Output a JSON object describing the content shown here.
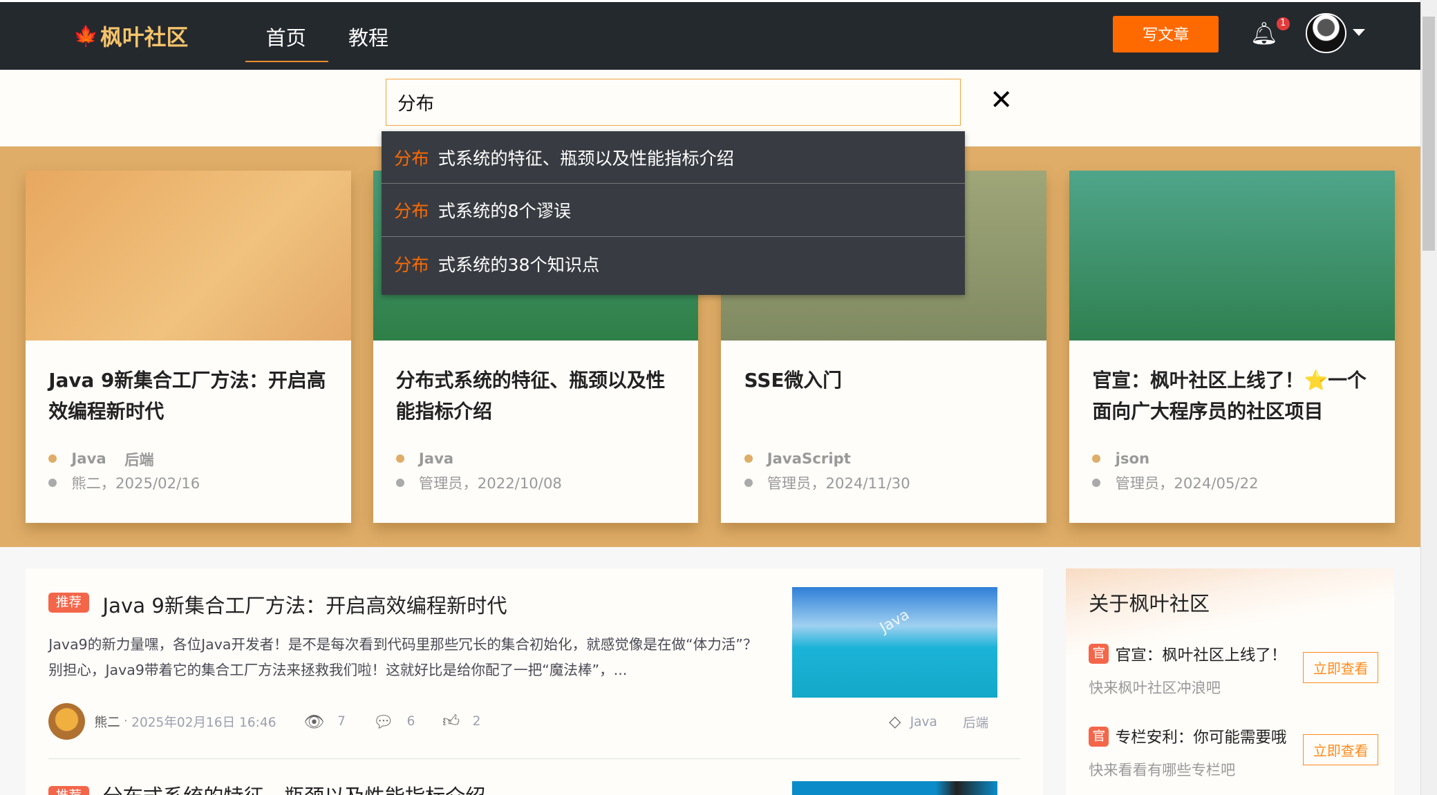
{
  "header": {
    "logo_text": "枫叶社区",
    "nav": [
      {
        "label": "首页",
        "active": true
      },
      {
        "label": "教程",
        "active": false
      }
    ],
    "write_button": "写文章",
    "notification_count": "1",
    "accent_color": "#ff6a00"
  },
  "search": {
    "value": "分布",
    "close_icon": "close-icon",
    "suggestions": [
      {
        "highlight": "分布",
        "rest": "式系统的特征、瓶颈以及性能指标介绍"
      },
      {
        "highlight": "分布",
        "rest": "式系统的8个谬误"
      },
      {
        "highlight": "分布",
        "rest": "式系统的38个知识点"
      }
    ]
  },
  "featured": [
    {
      "title": "Java 9新集合工厂方法：开启高效编程新时代",
      "tags": [
        "Java",
        "后端"
      ],
      "meta": "熊二，2025/02/16"
    },
    {
      "title": "分布式系统的特征、瓶颈以及性能指标介绍",
      "tags": [
        "Java"
      ],
      "meta": "管理员，2022/10/08"
    },
    {
      "title": "SSE微入门",
      "tags": [
        "JavaScript"
      ],
      "meta": "管理员，2024/11/30"
    },
    {
      "title": "官宣：枫叶社区上线了！⭐一个面向广大程序员的社区项目",
      "tags": [
        "json"
      ],
      "meta": "管理员，2024/05/22"
    }
  ],
  "articles": [
    {
      "badge": "推荐",
      "title": "Java 9新集合工厂方法：开启高效编程新时代",
      "summary": "Java9的新力量嘿，各位Java开发者！是不是每次看到代码里那些冗长的集合初始化，就感觉像是在做“体力活”？别担心，Java9带着它的集合工厂方法来拯救我们啦！这就好比是给你配了一把“魔法棒”，...",
      "thumb_text": "Java",
      "author": "熊二",
      "time": "2025年02月16日 16:46",
      "views": "7",
      "comments": "6",
      "likes": "2",
      "tags": [
        "Java",
        "后端"
      ]
    },
    {
      "badge": "推荐",
      "title": "分布式系统的特征、瓶颈以及性能指标介绍"
    }
  ],
  "sidebar": {
    "title": "关于枫叶社区",
    "items": [
      {
        "badge": "官",
        "title": "官宣：枫叶社区上线了！",
        "subtitle": "快来枫叶社区冲浪吧",
        "button": "立即查看"
      },
      {
        "badge": "官",
        "title": "专栏安利：你可能需要哦",
        "subtitle": "快来看看有哪些专栏吧",
        "button": "立即查看"
      }
    ]
  }
}
